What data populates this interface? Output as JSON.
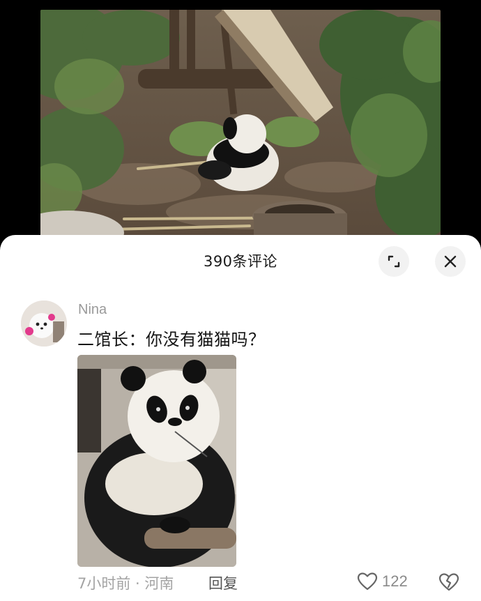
{
  "video": {
    "icon": "panda-video-frame"
  },
  "comments_panel": {
    "title": "390条评论",
    "expand_icon": "expand-icon",
    "close_icon": "close-icon"
  },
  "comment": {
    "author": "Nina",
    "text": "二馆长：你没有猫猫吗？",
    "image_icon": "panda-photo",
    "meta": "7小时前 · 河南",
    "reply_label": "回复",
    "like_count": "122",
    "like_icon": "heart-icon",
    "dislike_icon": "broken-heart-icon"
  }
}
